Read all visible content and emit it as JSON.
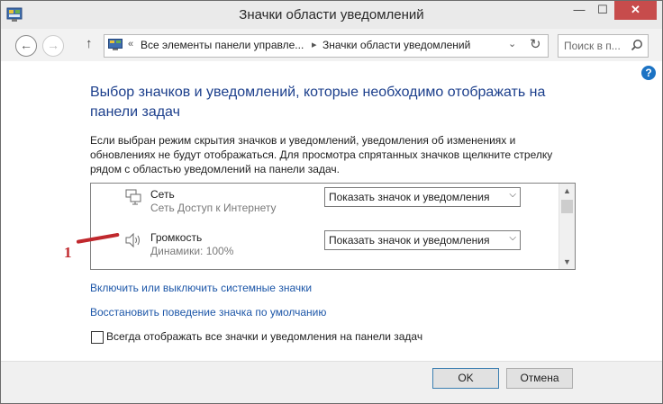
{
  "window": {
    "title": "Значки области уведомлений",
    "controls": {
      "minimize": "—",
      "maximize": "☐",
      "close": "✕"
    }
  },
  "navigation": {
    "back": "←",
    "forward": "→",
    "up": "↑",
    "address": {
      "sep1": "«",
      "crumb1": "Все элементы панели управле...",
      "sep2": "▸",
      "crumb2": "Значки области уведомлений",
      "dropdown": "⌄",
      "refresh": "↻"
    },
    "search": {
      "placeholder": "Поиск в п..."
    }
  },
  "help": "?",
  "main": {
    "heading": "Выбор значков и уведомлений, которые необходимо отображать на панели задач",
    "description": "Если выбран режим скрытия значков и уведомлений, уведомления об изменениях и обновлениях не будут отображаться. Для просмотра спрятанных значков щелкните стрелку рядом с областью уведомлений на панели задач.",
    "icons": [
      {
        "name": "Сеть",
        "subtitle": "Сеть Доступ к Интернету",
        "behavior": "Показать значок и уведомления",
        "icon": "network-icon"
      },
      {
        "name": "Громкость",
        "subtitle": "Динамики: 100%",
        "behavior": "Показать значок и уведомления",
        "icon": "speaker-icon"
      }
    ],
    "scroll": {
      "up": "▲",
      "down": "▼"
    },
    "annotation": "1",
    "link_system_icons": "Включить или выключить системные значки",
    "link_restore": "Восстановить поведение значка по умолчанию",
    "always_show_label": "Всегда отображать все значки и уведомления на панели задач",
    "always_show_checked": false
  },
  "footer": {
    "ok": "OK",
    "cancel": "Отмена"
  },
  "colors": {
    "heading": "#1c3f8c",
    "link": "#1c56a8",
    "annotation": "#c0282d",
    "close": "#c74c4c"
  }
}
